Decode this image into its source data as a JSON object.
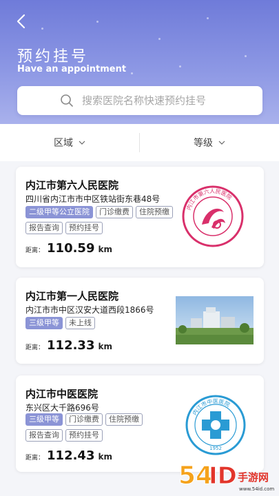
{
  "header": {
    "title_cn": "预约挂号",
    "title_en": "Have an appointment"
  },
  "search": {
    "placeholder": "搜索医院名称快速预约挂号"
  },
  "filters": [
    {
      "label": "区域"
    },
    {
      "label": "等级"
    }
  ],
  "distance_label": "距离：",
  "hospitals": [
    {
      "name": "内江市第六人民医院",
      "address": "四川省内江市市中区铁站街东巷48号",
      "tags": [
        {
          "text": "二级甲等公立医院",
          "primary": true
        },
        {
          "text": "门诊缴费",
          "primary": false
        },
        {
          "text": "住院预缴",
          "primary": false
        },
        {
          "text": "报告查询",
          "primary": false
        },
        {
          "text": "预约挂号",
          "primary": false
        }
      ],
      "distance": "110.59",
      "unit": "km",
      "logo": {
        "ring_text": "内江市第六人民医院",
        "en_text": "THE SIXTH PEOPLE'S HOSPITAL OF NEIJIANG",
        "color": "#d9306b"
      }
    },
    {
      "name": "内江市第一人民医院",
      "address": "内江市市中区汉安大道西段1866号",
      "tags": [
        {
          "text": "三级甲等",
          "primary": true
        },
        {
          "text": "未上线",
          "primary": false
        }
      ],
      "distance": "112.33",
      "unit": "km",
      "image": "hospital-building-photo"
    },
    {
      "name": "内江市中医医院",
      "address": "东兴区大千路696号",
      "tags": [
        {
          "text": "三级甲等",
          "primary": true
        },
        {
          "text": "门诊缴费",
          "primary": false
        },
        {
          "text": "住院预缴",
          "primary": false
        },
        {
          "text": "报告查询",
          "primary": false
        },
        {
          "text": "预约挂号",
          "primary": false
        }
      ],
      "distance": "112.43",
      "unit": "km",
      "logo": {
        "ring_text": "内江市中医医院",
        "year": "1952",
        "color": "#2a9bd4"
      }
    }
  ],
  "watermark": {
    "text": "54ID手游网",
    "url_text": "www.54id.com"
  }
}
